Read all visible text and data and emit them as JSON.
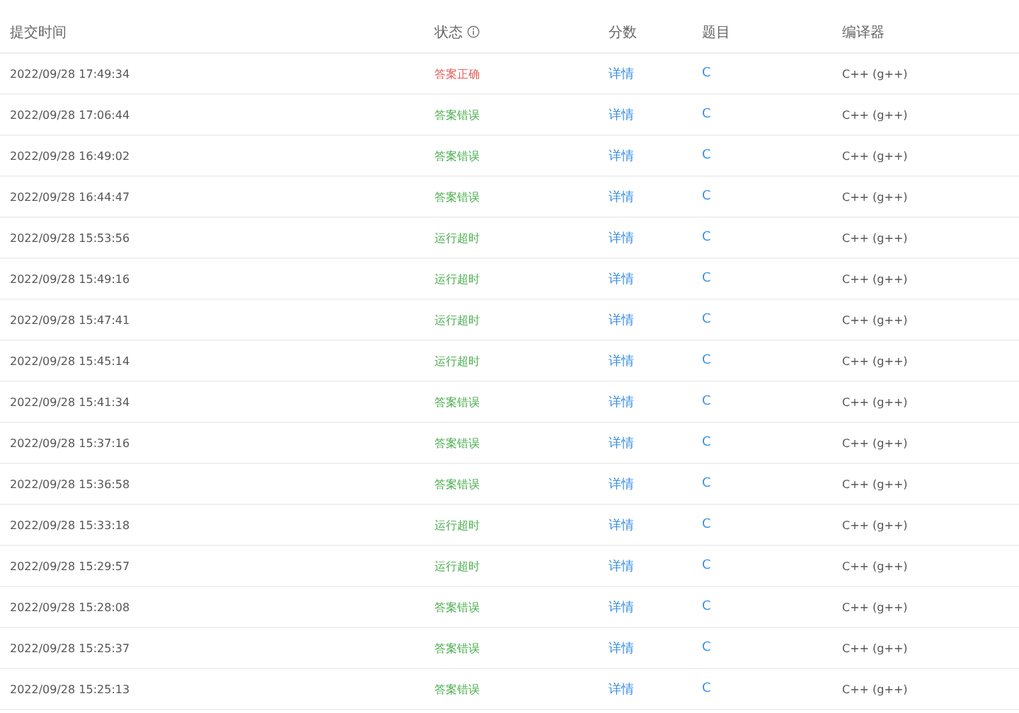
{
  "table": {
    "columns": [
      "提交时间",
      "状态",
      "分数",
      "题目",
      "编译器"
    ],
    "rows": [
      {
        "time": "2022/09/28 17:49:34",
        "status": "答案正确",
        "kind": "accepted",
        "score": "详情",
        "problem": "C",
        "compiler": "C++ (g++)"
      },
      {
        "time": "2022/09/28 17:06:44",
        "status": "答案错误",
        "kind": "wrong",
        "score": "详情",
        "problem": "C",
        "compiler": "C++ (g++)"
      },
      {
        "time": "2022/09/28 16:49:02",
        "status": "答案错误",
        "kind": "wrong",
        "score": "详情",
        "problem": "C",
        "compiler": "C++ (g++)"
      },
      {
        "time": "2022/09/28 16:44:47",
        "status": "答案错误",
        "kind": "wrong",
        "score": "详情",
        "problem": "C",
        "compiler": "C++ (g++)"
      },
      {
        "time": "2022/09/28 15:53:56",
        "status": "运行超时",
        "kind": "timeout",
        "score": "详情",
        "problem": "C",
        "compiler": "C++ (g++)"
      },
      {
        "time": "2022/09/28 15:49:16",
        "status": "运行超时",
        "kind": "timeout",
        "score": "详情",
        "problem": "C",
        "compiler": "C++ (g++)"
      },
      {
        "time": "2022/09/28 15:47:41",
        "status": "运行超时",
        "kind": "timeout",
        "score": "详情",
        "problem": "C",
        "compiler": "C++ (g++)"
      },
      {
        "time": "2022/09/28 15:45:14",
        "status": "运行超时",
        "kind": "timeout",
        "score": "详情",
        "problem": "C",
        "compiler": "C++ (g++)"
      },
      {
        "time": "2022/09/28 15:41:34",
        "status": "答案错误",
        "kind": "wrong",
        "score": "详情",
        "problem": "C",
        "compiler": "C++ (g++)"
      },
      {
        "time": "2022/09/28 15:37:16",
        "status": "答案错误",
        "kind": "wrong",
        "score": "详情",
        "problem": "C",
        "compiler": "C++ (g++)"
      },
      {
        "time": "2022/09/28 15:36:58",
        "status": "答案错误",
        "kind": "wrong",
        "score": "详情",
        "problem": "C",
        "compiler": "C++ (g++)"
      },
      {
        "time": "2022/09/28 15:33:18",
        "status": "运行超时",
        "kind": "timeout",
        "score": "详情",
        "problem": "C",
        "compiler": "C++ (g++)"
      },
      {
        "time": "2022/09/28 15:29:57",
        "status": "运行超时",
        "kind": "timeout",
        "score": "详情",
        "problem": "C",
        "compiler": "C++ (g++)"
      },
      {
        "time": "2022/09/28 15:28:08",
        "status": "答案错误",
        "kind": "wrong",
        "score": "详情",
        "problem": "C",
        "compiler": "C++ (g++)"
      },
      {
        "time": "2022/09/28 15:25:37",
        "status": "答案错误",
        "kind": "wrong",
        "score": "详情",
        "problem": "C",
        "compiler": "C++ (g++)"
      },
      {
        "time": "2022/09/28 15:25:13",
        "status": "答案错误",
        "kind": "wrong",
        "score": "详情",
        "problem": "C",
        "compiler": "C++ (g++)"
      }
    ]
  }
}
